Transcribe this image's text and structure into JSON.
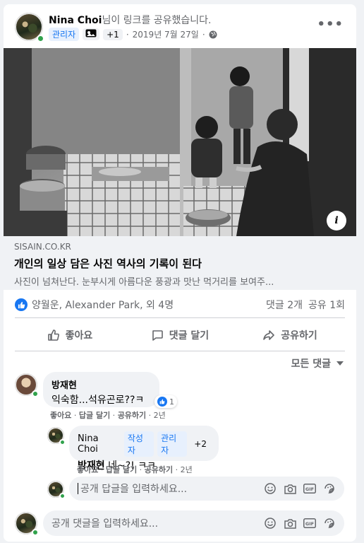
{
  "post": {
    "author": "Nina Choi",
    "action": "님이 링크를 공유했습니다.",
    "badge_admin": "관리자",
    "badge_plus": "+1",
    "date": "2019년 7월 27일",
    "separator": "·"
  },
  "link": {
    "domain": "SISAIN.CO.KR",
    "title": "개인의 일상 담은 사진 역사의 기록이 된다",
    "description": "사진이 넘쳐난다. 눈부시게 아름다운 풍광과 맛난 먹거리를 보여주..."
  },
  "reactions": {
    "names": "양월운, Alexander Park, 외 4명",
    "comments": "댓글 2개",
    "shares": "공유 1회"
  },
  "actions": {
    "like": "좋아요",
    "comment": "댓글 달기",
    "share": "공유하기"
  },
  "sort_label": "모든 댓글",
  "comments": [
    {
      "author": "방재현",
      "text": "익숙함...석유곤로??ㅋ",
      "reaction_count": "1",
      "like": "좋아요",
      "reply": "답글 달기",
      "share": "공유하기",
      "time": "2년"
    }
  ],
  "reply": {
    "author": "Nina Choi",
    "badge_author": "작성자",
    "badge_admin": "관리자",
    "badge_plus": "+2",
    "mention": "방재현",
    "text": " 네~?! ㅋㅋ",
    "like": "좋아요",
    "reply": "답글 달기",
    "share": "공유하기",
    "time": "2년"
  },
  "reply_input": {
    "placeholder": "공개 답글을 입력하세요..."
  },
  "comment_input": {
    "placeholder": "공개 댓글을 입력하세요..."
  },
  "colors": {
    "accent": "#1877f2",
    "online": "#31a24c",
    "bubble": "#f0f2f5"
  }
}
